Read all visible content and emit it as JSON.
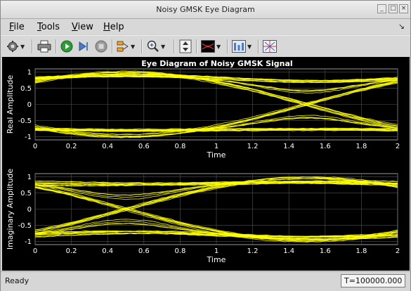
{
  "window": {
    "title": "Noisy GMSK Eye Diagram"
  },
  "menu": {
    "items": [
      {
        "label": "File",
        "underline": "F",
        "rest": "ile"
      },
      {
        "label": "Tools",
        "underline": "T",
        "rest": "ools"
      },
      {
        "label": "View",
        "underline": "V",
        "rest": "iew"
      },
      {
        "label": "Help",
        "underline": "H",
        "rest": "elp"
      }
    ]
  },
  "toolbar": {
    "icons": [
      "settings-icon",
      "print-icon",
      "run-icon",
      "step-forward-icon",
      "stop-icon",
      "highlight-icon",
      "zoom-in-icon",
      "scale-axes-icon",
      "measurements-icon",
      "style-icon",
      "eye-diagram-icon"
    ]
  },
  "status": {
    "left": "Ready",
    "time": "T=100000.000"
  },
  "chart_data": {
    "type": "line",
    "title": "Eye Diagram of Noisy GMSK Signal",
    "colors": {
      "trace": "#ffff00",
      "background": "#000000",
      "axes_text": "#ffffff",
      "grid": "#555555"
    },
    "panels": [
      {
        "ylabel": "Real Amplitude",
        "xlabel": "Time",
        "xlim": [
          0,
          2
        ],
        "ylim": [
          -1.1,
          1.1
        ],
        "xticks": [
          "0",
          "0.2",
          "0.4",
          "0.6",
          "0.8",
          "1",
          "1.2",
          "1.4",
          "1.6",
          "1.8",
          "2"
        ],
        "yticks": [
          "1",
          "0.5",
          "0",
          "-0.5",
          "-1"
        ],
        "grid": true,
        "crossing_time": 1.5,
        "upper_level": 0.8,
        "lower_level": -0.78
      },
      {
        "ylabel": "Imaginary Amplitude",
        "xlabel": "Time",
        "xlim": [
          0,
          2
        ],
        "ylim": [
          -1.1,
          1.1
        ],
        "xticks": [
          "0",
          "0.2",
          "0.4",
          "0.6",
          "0.8",
          "1",
          "1.2",
          "1.4",
          "1.6",
          "1.8",
          "2"
        ],
        "yticks": [
          "1",
          "0.5",
          "0",
          "-0.5",
          "-1"
        ],
        "grid": true,
        "crossing_time": 0.5,
        "upper_level": 0.8,
        "lower_level": -0.8
      }
    ]
  }
}
